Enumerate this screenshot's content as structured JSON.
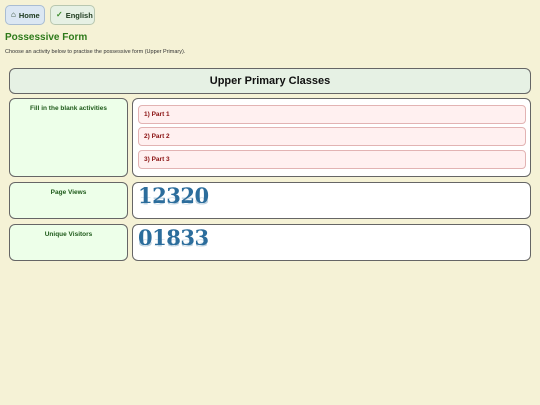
{
  "nav": {
    "home": {
      "label": "Home",
      "icon": "house-icon"
    },
    "english": {
      "label": "English",
      "icon": "checkmark-icon"
    }
  },
  "page": {
    "title": "Possessive Form",
    "subtitle": "Choose an activity below to practise the possessive form (Upper Primary)."
  },
  "table": {
    "header": "Upper Primary Classes",
    "activities": {
      "label": "Fill in the blank activities",
      "items": [
        "1) Part 1",
        "2) Part 2",
        "3) Part 3"
      ]
    },
    "page_views": {
      "label": "Page Views",
      "value": "12320"
    },
    "unique_visitors": {
      "label": "Unique Visitors",
      "value": "01833"
    }
  },
  "colors": {
    "background": "#f5f2d6",
    "title": "#2d7a1a",
    "link_text": "#8a1111",
    "counter": "#2c6d9c"
  }
}
